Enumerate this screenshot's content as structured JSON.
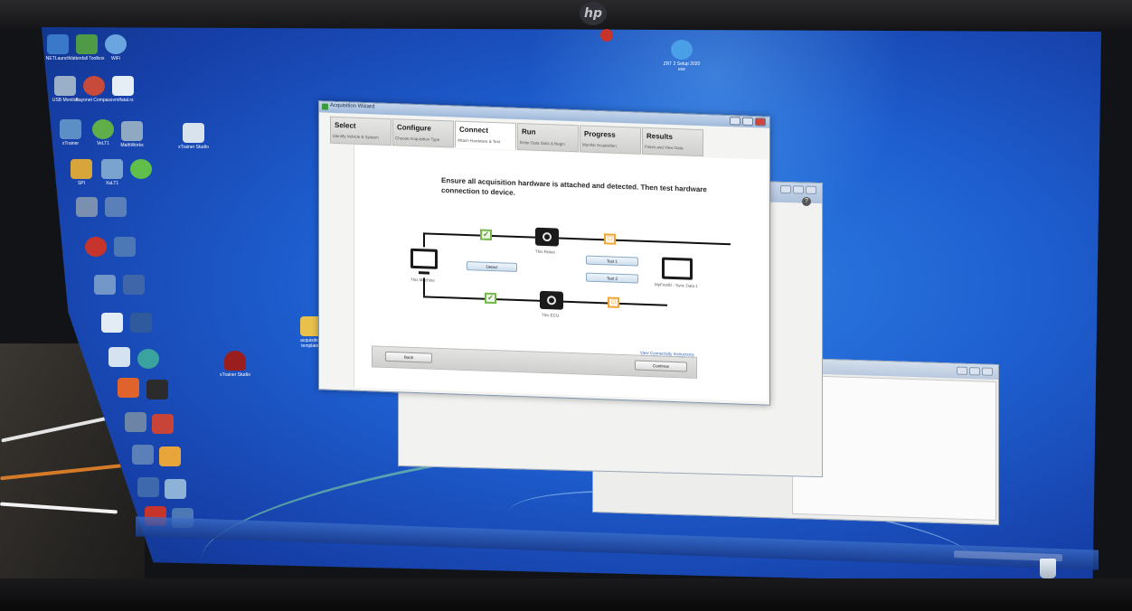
{
  "wizard": {
    "title": "Acquisition Wizard",
    "tabs": [
      {
        "label": "Select",
        "sub": "Identify Vehicle & System"
      },
      {
        "label": "Configure",
        "sub": "Choose Acquisition Type"
      },
      {
        "label": "Connect",
        "sub": "Attach Hardware & Test"
      },
      {
        "label": "Run",
        "sub": "Enter Data Slots & Begin"
      },
      {
        "label": "Progress",
        "sub": "Monitor Acquisition"
      },
      {
        "label": "Results",
        "sub": "Finish and View Data"
      }
    ],
    "active_tab": "Connect",
    "instruction": "Ensure all acquisition hardware is attached and detected. Then test hardware connection to device.",
    "diagram": {
      "host_label": "This Machine",
      "target_label": "MyFirstID - Sync Data 1",
      "top_device_label": "This Robot",
      "bottom_device_label": "This ECU",
      "detect_button": "Detect",
      "test1_button": "Test 1",
      "test2_button": "Test 2",
      "check_glyph": "✓",
      "pending_glyph": "□"
    },
    "help_link": "View Connectivity Instructions",
    "back_button": "Back",
    "continue_button": "Continue"
  },
  "desktop": {
    "icons": [
      {
        "label": "NETLaunch"
      },
      {
        "label": "Vattenfall Toolbox"
      },
      {
        "label": "WiFi"
      },
      {
        "label": "USB Monitor"
      },
      {
        "label": "Bayonet Compass"
      },
      {
        "label": "vrnlfatal.rs"
      },
      {
        "label": "xTrainer"
      },
      {
        "label": "VeLT1"
      },
      {
        "label": "MathWorks"
      },
      {
        "label": "xTrainer Studio"
      },
      {
        "label": "SPI"
      },
      {
        "label": "XaLT1"
      },
      {
        "label": "xTrainer Studio"
      },
      {
        "label": "acquisition templates"
      },
      {
        "label": "ZRT 2 Setup 2020 exe"
      }
    ],
    "taskbar_label": "taskbar"
  },
  "colors": {
    "desktop_blue": "#1e5fd0",
    "check_green": "#74b84a",
    "pending_orange": "#f0a73a"
  }
}
